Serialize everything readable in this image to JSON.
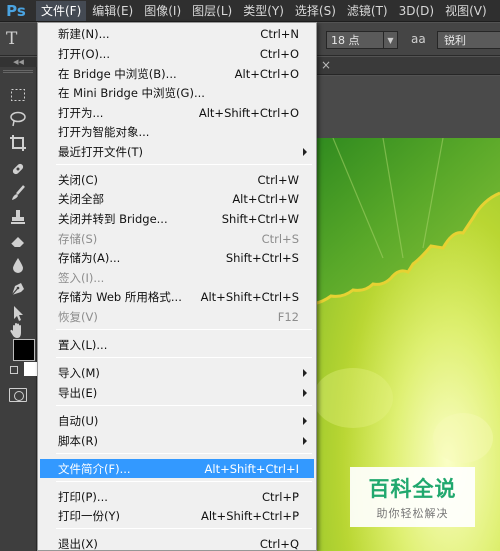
{
  "app": {
    "logo": "Ps"
  },
  "menubar": {
    "items": [
      {
        "label": "文件(F)",
        "active": true
      },
      {
        "label": "编辑(E)"
      },
      {
        "label": "图像(I)"
      },
      {
        "label": "图层(L)"
      },
      {
        "label": "类型(Y)"
      },
      {
        "label": "选择(S)"
      },
      {
        "label": "滤镜(T)"
      },
      {
        "label": "3D(D)"
      },
      {
        "label": "视图(V)"
      }
    ]
  },
  "options": {
    "tool_glyph": "T",
    "font_size": "18 点",
    "aa_glyph": "aa",
    "antialias": "锐利"
  },
  "doc_tab": {
    "close": "×"
  },
  "file_menu": {
    "items": [
      {
        "label": "新建(N)...",
        "shortcut": "Ctrl+N"
      },
      {
        "label": "打开(O)...",
        "shortcut": "Ctrl+O"
      },
      {
        "label": "在 Bridge 中浏览(B)...",
        "shortcut": "Alt+Ctrl+O"
      },
      {
        "label": "在 Mini Bridge 中浏览(G)...",
        "shortcut": ""
      },
      {
        "label": "打开为...",
        "shortcut": "Alt+Shift+Ctrl+O"
      },
      {
        "label": "打开为智能对象...",
        "shortcut": ""
      },
      {
        "label": "最近打开文件(T)",
        "shortcut": "",
        "submenu": true
      },
      {
        "label": "关闭(C)",
        "shortcut": "Ctrl+W"
      },
      {
        "label": "关闭全部",
        "shortcut": "Alt+Ctrl+W"
      },
      {
        "label": "关闭并转到 Bridge...",
        "shortcut": "Shift+Ctrl+W"
      },
      {
        "label": "存储(S)",
        "shortcut": "Ctrl+S",
        "disabled": true
      },
      {
        "label": "存储为(A)...",
        "shortcut": "Shift+Ctrl+S"
      },
      {
        "label": "签入(I)...",
        "shortcut": "",
        "disabled": true
      },
      {
        "label": "存储为 Web 所用格式...",
        "shortcut": "Alt+Shift+Ctrl+S"
      },
      {
        "label": "恢复(V)",
        "shortcut": "F12",
        "disabled": true
      },
      {
        "label": "置入(L)...",
        "shortcut": ""
      },
      {
        "label": "导入(M)",
        "shortcut": "",
        "submenu": true
      },
      {
        "label": "导出(E)",
        "shortcut": "",
        "submenu": true
      },
      {
        "label": "自动(U)",
        "shortcut": "",
        "submenu": true
      },
      {
        "label": "脚本(R)",
        "shortcut": "",
        "submenu": true
      },
      {
        "label": "文件简介(F)...",
        "shortcut": "Alt+Shift+Ctrl+I",
        "highlighted": true
      },
      {
        "label": "打印(P)...",
        "shortcut": "Ctrl+P"
      },
      {
        "label": "打印一份(Y)",
        "shortcut": "Alt+Shift+Ctrl+P"
      },
      {
        "label": "退出(X)",
        "shortcut": "Ctrl+Q"
      }
    ]
  },
  "watermark": {
    "title": "百科全说",
    "subtitle": "助你轻松解决"
  },
  "colors": {
    "accent": "#3399ff",
    "menubar_bg": "#2f2f2f",
    "workspace_bg": "#535353",
    "menu_bg": "#f0f0f0",
    "watermark_green": "#21a86e"
  },
  "tools": [
    "marquee-icon",
    "lasso-icon",
    "crop-icon",
    "healing-brush-icon",
    "brush-icon",
    "clone-stamp-icon",
    "eraser-icon",
    "blur-icon",
    "pen-icon",
    "path-selection-icon",
    "hand-icon"
  ]
}
